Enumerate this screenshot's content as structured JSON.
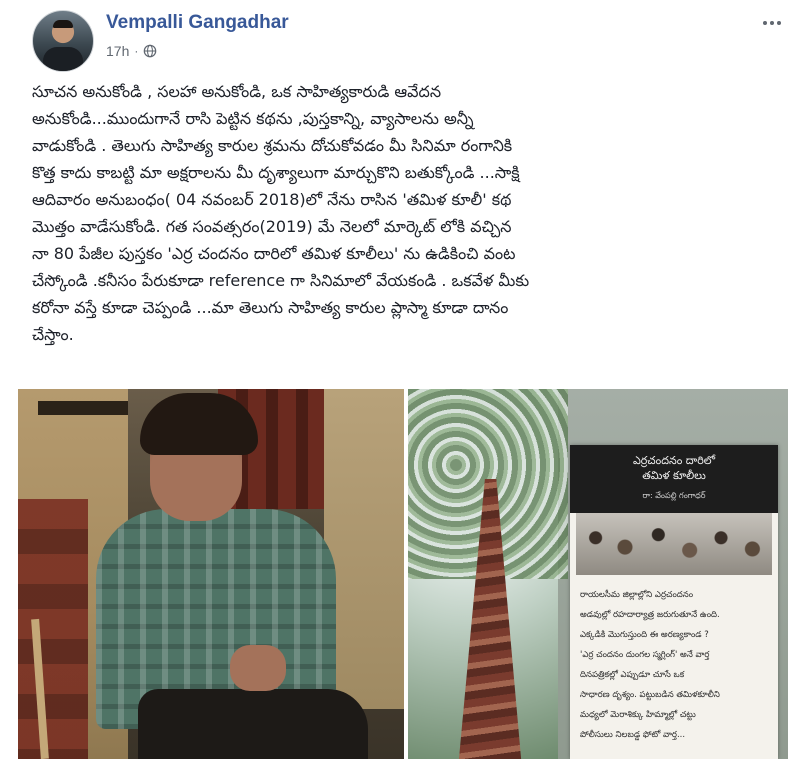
{
  "post": {
    "author": "Vempalli Gangadhar",
    "time": "17h",
    "separator": "·",
    "privacy_icon": "globe-icon",
    "more_icon": "more-options-icon",
    "text_lines": [
      "సూచన అనుకోండి , సలహా అనుకోండి, ఒక సాహిత్యకారుడి ఆవేదన",
      "అనుకోండి...ముందుగానే రాసి పెట్టిన కథను ,పుస్తకాన్ని, వ్యాసాలను అన్నీ",
      "వాడుకోండి . తెలుగు సాహిత్య కారుల శ్రమను దోచుకోవడం మీ సినిమా రంగానికి",
      "కొత్త కాదు కాబట్టి మా అక్షరాలను మీ దృశ్యాలుగా మార్చుకొని బతుక్కోండి ...సాక్షి",
      "ఆదివారం అనుబంధం( 04 నవంబర్ 2018)లో నేను రాసిన 'తమిళ కూలీ' కథ",
      "మొత్తం వాడేసుకోండి. గత సంవత్సరం(2019) మే నెలలో మార్కెట్ లోకి వచ్చిన",
      "నా 80 పేజీల పుస్తకం 'ఎర్ర చందనం దారిలో తమిళ కూలీలు' ను ఉడికించి వంట",
      "చేస్కోండి .కనీసం పేరుకూడా reference గా సినిమాలో వేయకండి . ఒకవేళ మీకు",
      "కరోనా వస్తే కూడా చెప్పండి ...మా తెలుగు సాహిత్య కారుల ప్లాస్మా కూడా దానం",
      "చేస్తాం."
    ]
  },
  "book": {
    "title_line1": "ఎర్రచందనం దారిలో",
    "title_line2": "తమిళ కూలీలు",
    "author": "రా: వేంపల్లి గంగాధర్",
    "body_lines": [
      "రాయలసీమ జిల్లాల్లోని ఎర్రచందనం",
      "అడవుల్లో రహదార్యాత్ర జరుగుతూనే ఉంది.",
      "ఎక్కడికి మొగుస్తుంది ఈ అరణ్యకాండ ?",
      "'ఎర్ర చందనం దుంగల స్మగ్లింగ్' అనే వార్త",
      "దినపత్రికల్లో ఎప్పుడూ చూసే ఒక",
      "సాధారణ దృశ్యం. పట్టుబడిన తమిళకూలీని",
      "మధ్యలో మెరాశిక్కు హిమ్మాల్లో చట్టు",
      "పోలీసులు నిలబడ్డ ఫోటో వార్త..."
    ]
  }
}
